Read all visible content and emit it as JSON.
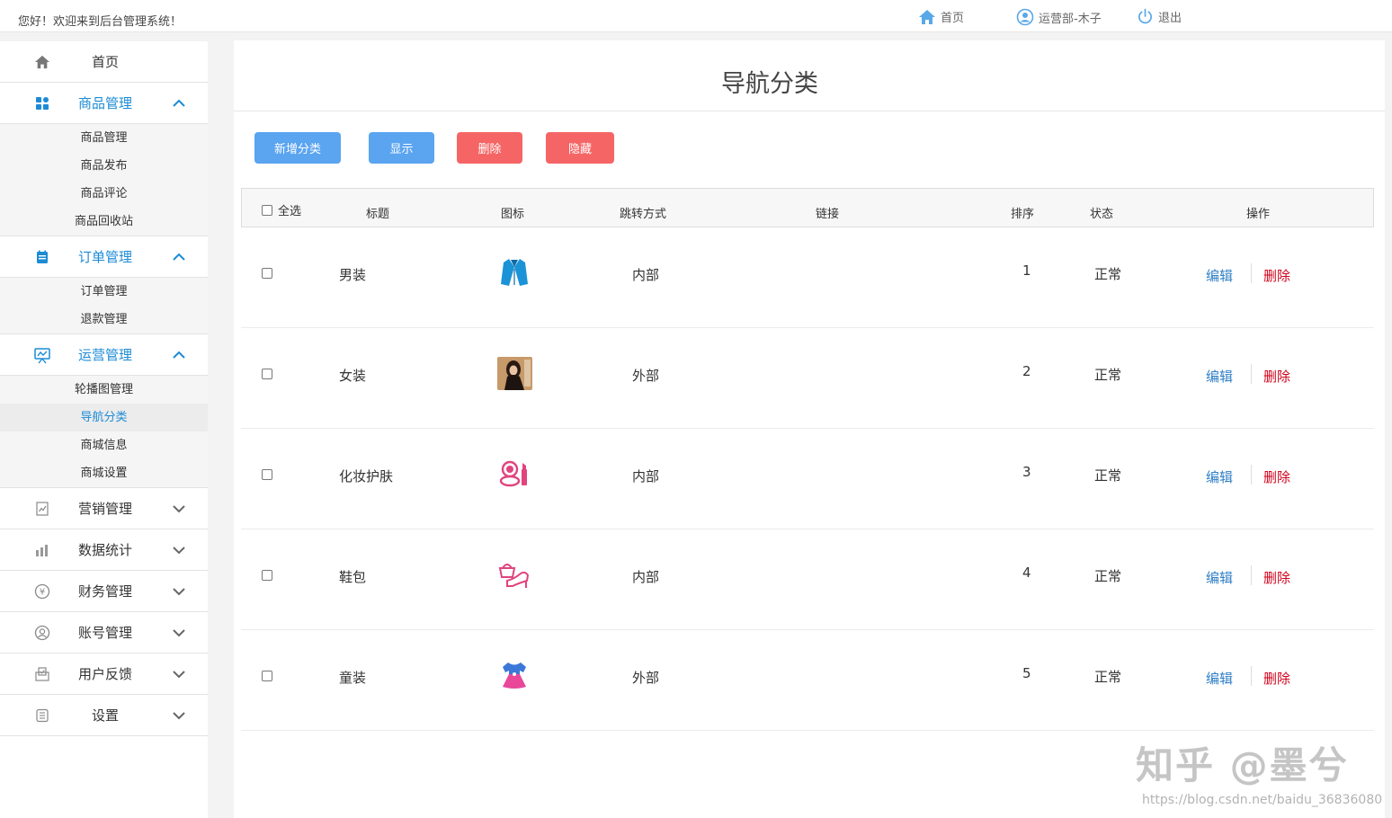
{
  "topbar": {
    "greeting": "您好！欢迎来到后台管理系统！",
    "home": "首页",
    "user": "运营部-木子",
    "logout": "退出"
  },
  "sidebar": {
    "home": "首页",
    "groups": [
      {
        "label": "商品管理",
        "icon": "grid-icon",
        "items": [
          "商品管理",
          "商品发布",
          "商品评论",
          "商品回收站"
        ]
      },
      {
        "label": "订单管理",
        "icon": "calendar-icon",
        "items": [
          "订单管理",
          "退款管理"
        ]
      },
      {
        "label": "运营管理",
        "icon": "monitor-icon",
        "items": [
          "轮播图管理",
          "导航分类",
          "商城信息",
          "商城设置"
        ]
      }
    ],
    "collapsed": [
      "营销管理",
      "数据统计",
      "财务管理",
      "账号管理",
      "用户反馈",
      "设置"
    ]
  },
  "page": {
    "title": "导航分类",
    "buttons": {
      "add": "新增分类",
      "show": "显示",
      "delete": "删除",
      "hide": "隐藏"
    }
  },
  "table": {
    "headers": {
      "select_all": "全选",
      "title": "标题",
      "icon": "图标",
      "jump": "跳转方式",
      "link": "链接",
      "sort": "排序",
      "status": "状态",
      "ops": "操作"
    },
    "rows": [
      {
        "title": "男装",
        "icon": "mens-jacket-icon",
        "jump": "内部",
        "link": "",
        "sort": "1",
        "status": "正常",
        "edit": "编辑",
        "delete": "删除"
      },
      {
        "title": "女装",
        "icon": "woman-photo-icon",
        "jump": "外部",
        "link": "",
        "sort": "2",
        "status": "正常",
        "edit": "编辑",
        "delete": "删除"
      },
      {
        "title": "化妆护肤",
        "icon": "cosmetics-icon",
        "jump": "内部",
        "link": "",
        "sort": "3",
        "status": "正常",
        "edit": "编辑",
        "delete": "删除"
      },
      {
        "title": "鞋包",
        "icon": "shoe-bag-icon",
        "jump": "内部",
        "link": "",
        "sort": "4",
        "status": "正常",
        "edit": "编辑",
        "delete": "删除"
      },
      {
        "title": "童装",
        "icon": "kids-dress-icon",
        "jump": "外部",
        "link": "",
        "sort": "5",
        "status": "正常",
        "edit": "编辑",
        "delete": "删除"
      }
    ]
  },
  "watermark": {
    "brand": "知乎 @墨兮",
    "url": "https://blog.csdn.net/baidu_36836080"
  },
  "colors": {
    "accent": "#1c8bd6",
    "primary_button": "#5aa4f0",
    "danger_button": "#f66565",
    "edit_link": "#2f7fc6",
    "delete_link": "#d0021b"
  }
}
